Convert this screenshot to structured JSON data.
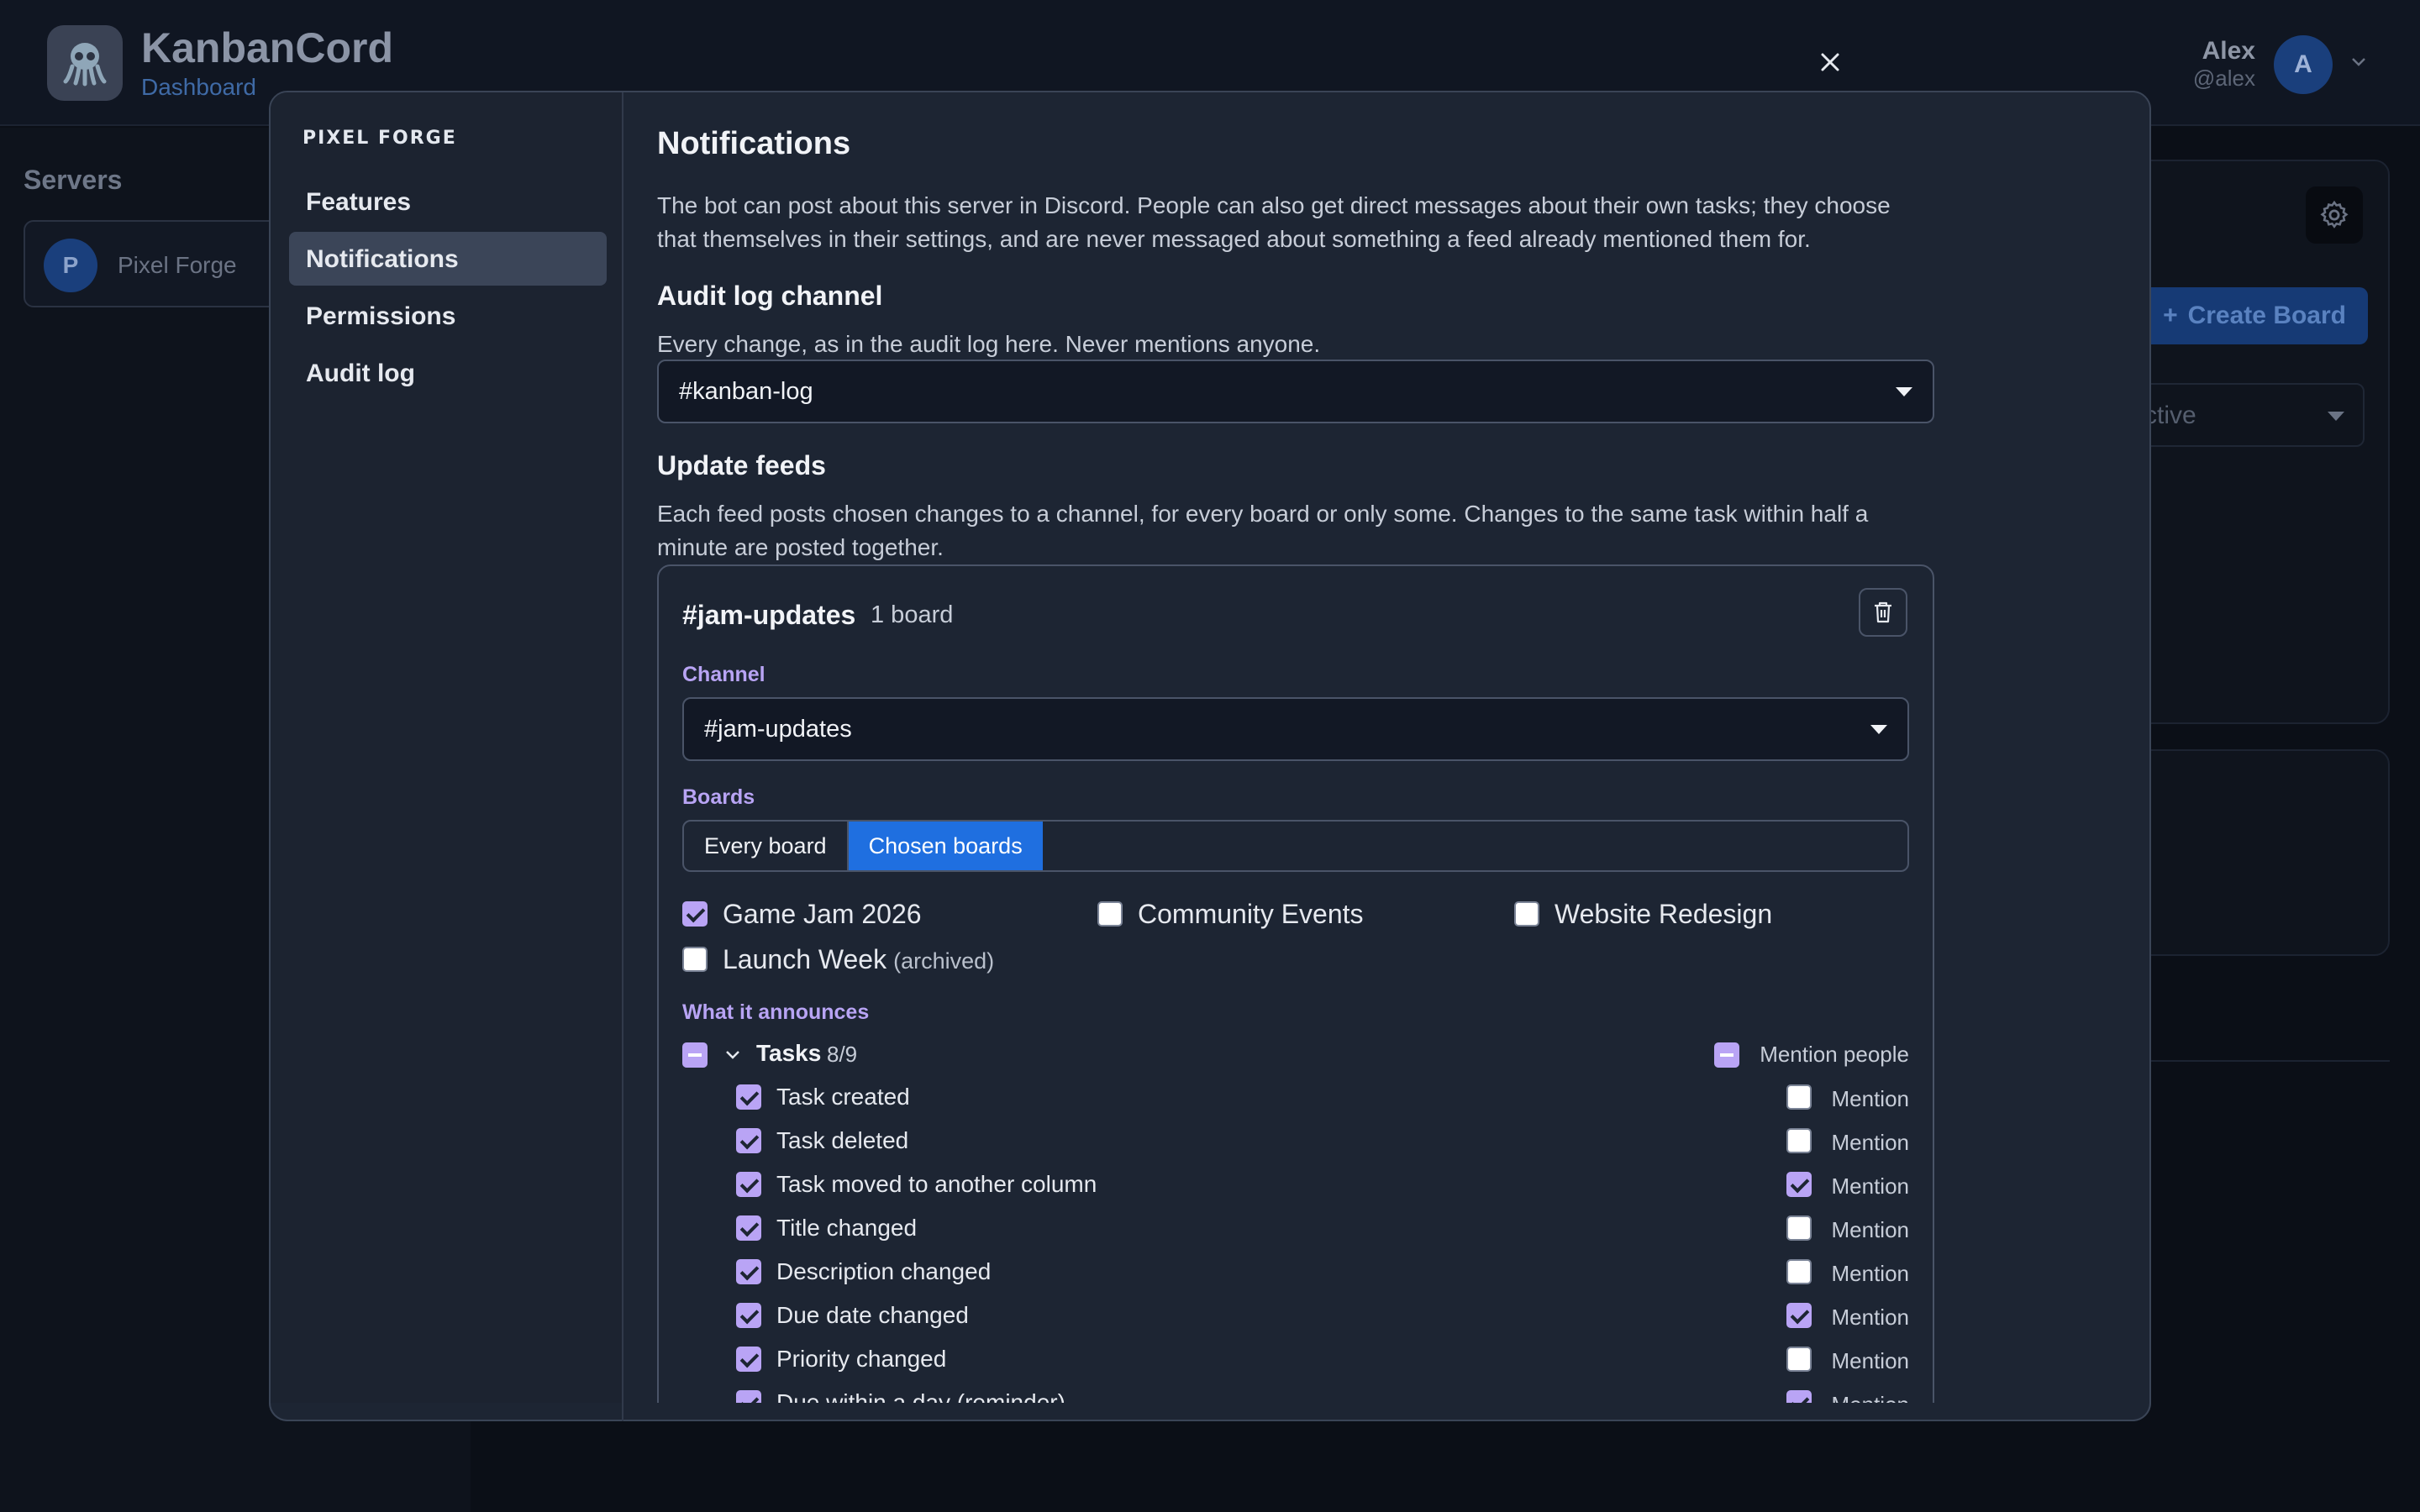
{
  "app": {
    "title": "KanbanCord",
    "subtitle": "Dashboard"
  },
  "user": {
    "name": "Alex",
    "handle": "@alex",
    "avatar_letter": "A"
  },
  "servers": {
    "title": "Servers",
    "items": [
      {
        "letter": "P",
        "name": "Pixel Forge"
      }
    ]
  },
  "background": {
    "create_board_label": "Create Board",
    "filter_value": "ctive"
  },
  "modal": {
    "server_heading": "PIXEL FORGE",
    "nav": [
      "Features",
      "Notifications",
      "Permissions",
      "Audit log"
    ],
    "active_nav": "Notifications",
    "title": "Notifications",
    "intro_line1": "The bot can post about this server in Discord. People can also get direct messages about their own tasks; they choose",
    "intro_line2": "that themselves in their settings, and are never messaged about something a feed already mentioned them for.",
    "audit": {
      "title": "Audit log channel",
      "description": "Every change, as in the audit log here. Never mentions anyone.",
      "channel": "#kanban-log"
    },
    "feeds": {
      "title": "Update feeds",
      "description_line1": "Each feed posts chosen changes to a channel, for every board or only some. Changes to the same task within half a",
      "description_line2": "minute are posted together.",
      "feed": {
        "name": "#jam-updates",
        "board_count": "1 board",
        "channel_label": "Channel",
        "channel": "#jam-updates",
        "boards_label": "Boards",
        "scope_options": [
          "Every board",
          "Chosen boards"
        ],
        "scope_selected": "Chosen boards",
        "boards": [
          {
            "name": "Game Jam 2026",
            "checked": true,
            "archived": ""
          },
          {
            "name": "Community Events",
            "checked": false,
            "archived": ""
          },
          {
            "name": "Website Redesign",
            "checked": false,
            "archived": ""
          },
          {
            "name": "Launch Week",
            "checked": false,
            "archived": "(archived)"
          }
        ],
        "announces_label": "What it announces",
        "group": {
          "name": "Tasks",
          "count": "8/9",
          "mention_all_label": "Mention people"
        },
        "events": [
          {
            "label": "Task created",
            "checked": true,
            "mention": false
          },
          {
            "label": "Task deleted",
            "checked": true,
            "mention": false
          },
          {
            "label": "Task moved to another column",
            "checked": true,
            "mention": true
          },
          {
            "label": "Title changed",
            "checked": true,
            "mention": false
          },
          {
            "label": "Description changed",
            "checked": true,
            "mention": false
          },
          {
            "label": "Due date changed",
            "checked": true,
            "mention": true
          },
          {
            "label": "Priority changed",
            "checked": true,
            "mention": false
          },
          {
            "label": "Due within a day (reminder)",
            "checked": true,
            "mention": true
          }
        ],
        "mention_label": "Mention"
      }
    }
  },
  "colors": {
    "accent": "#1f6fe0",
    "check": "#b9a4f5",
    "modal_bg": "#1d2533"
  }
}
